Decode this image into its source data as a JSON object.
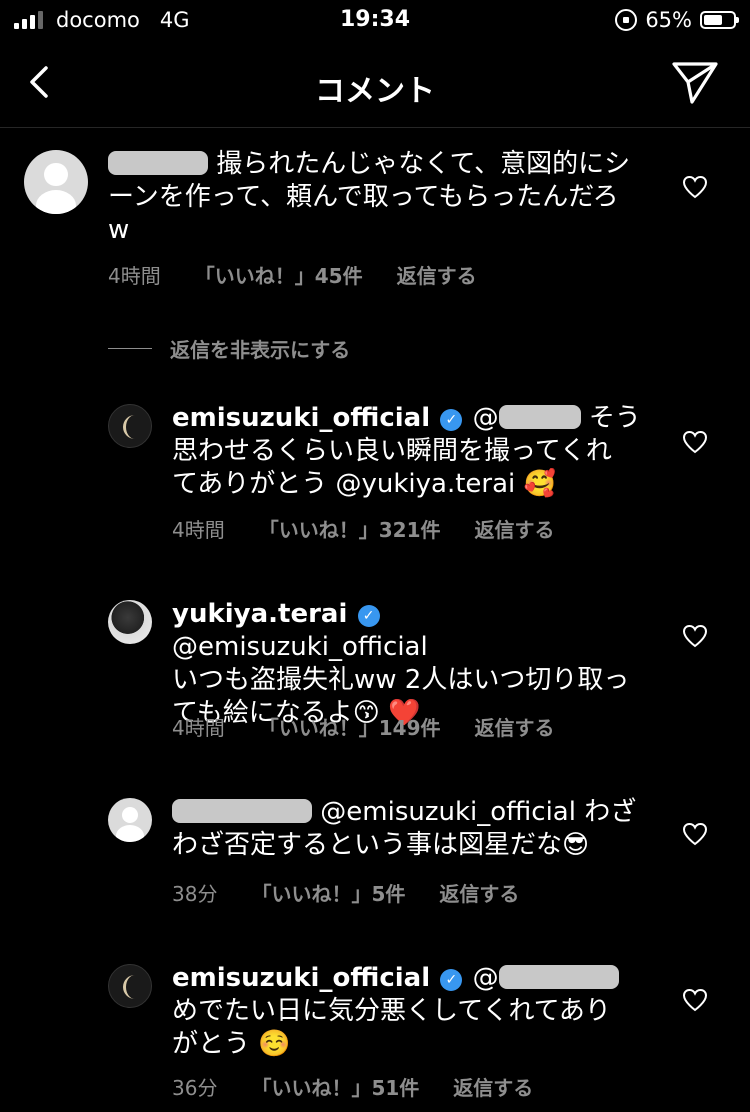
{
  "status_bar": {
    "carrier": "docomo",
    "network": "4G",
    "time": "19:34",
    "battery_percent": "65%",
    "battery_level": 0.65
  },
  "header": {
    "title": "コメント",
    "back_icon": "chevron-left-icon",
    "send_icon": "paper-plane-icon"
  },
  "comments": [
    {
      "username": "",
      "text": "撮られたんじゃなくて、意図的にシ",
      "text2": "ーンを作って、頼んで取ってもらったんだろ",
      "text3": "w",
      "time": "4時間",
      "likes": "「いいね！」45件",
      "reply": "返信する"
    },
    {
      "username": "emisuzuki_official",
      "mention_prefix": "@",
      "text": "そう",
      "text2": "思わせるくらい良い瞬間を撮ってくれ",
      "text3": "てありがとう @yukiya.terai 🥰",
      "time": "4時間",
      "likes": "「いいね！」321件",
      "reply": "返信する"
    },
    {
      "username": "yukiya.terai",
      "text": "@emisuzuki_official",
      "text2": "いつも盗撮失礼ww 2人はいつ切り取っ",
      "text3": "ても絵になるよ😙 ❤️",
      "time": "4時間",
      "likes": "「いいね！」149件",
      "reply": "返信する"
    },
    {
      "username": "",
      "text": "@emisuzuki_official わざ",
      "text2": "わざ否定するという事は図星だな😎",
      "time": "38分",
      "likes": "「いいね！」5件",
      "reply": "返信する"
    },
    {
      "username": "emisuzuki_official",
      "mention_prefix": "@",
      "text2": "めでたい日に気分悪くしてくれてあり",
      "text3": "がとう ☺️",
      "time": "36分",
      "likes": "「いいね！」51件",
      "reply": "返信する"
    }
  ],
  "hide_replies_label": "返信を非表示にする",
  "colors": {
    "background": "#000000",
    "text": "#ffffff",
    "secondary": "#8e8e8e",
    "verified": "#3897f0"
  }
}
